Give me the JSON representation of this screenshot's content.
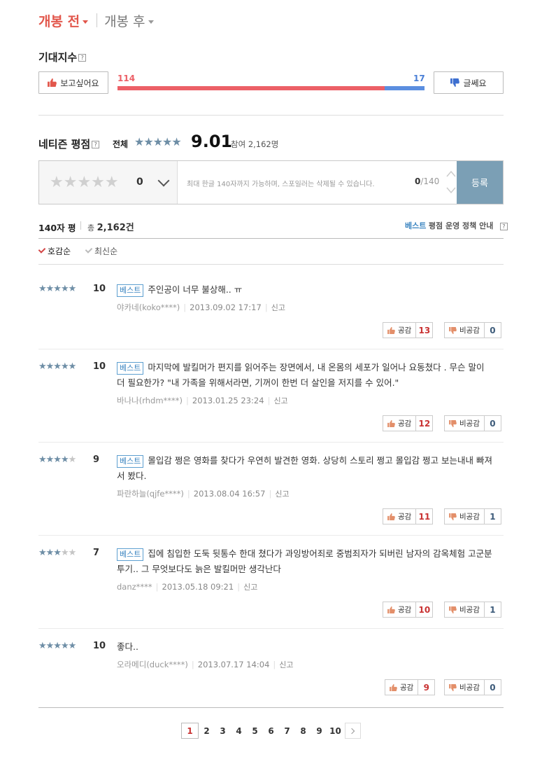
{
  "tabs": {
    "before_label": "개봉 전",
    "after_label": "개봉 후"
  },
  "expectation": {
    "title": "기대지수",
    "help": "?",
    "like_label": "보고싶어요",
    "dislike_label": "글쎄요",
    "like_count": "114",
    "dislike_count": "17",
    "like_ratio": 0.87
  },
  "netizen": {
    "title": "네티즌 평점",
    "help": "?",
    "scope_label": "전체",
    "stars": "★★★★★",
    "score": "9.01",
    "participants": "참여 2,162명"
  },
  "input": {
    "stars": "★★★★★",
    "value": "0",
    "placeholder": "최대 한글 140자까지 가능하며, 스포일러는 삭제될 수 있습니다.",
    "count_current": "0",
    "count_max": "/140",
    "submit_label": "등록"
  },
  "list_header": {
    "title": "140자 평",
    "total_prefix": "총",
    "total": "2,162건",
    "best_label": "베스트",
    "policy_label": "평점 운영 정책 안내",
    "help": "?"
  },
  "sort": {
    "likes_label": "호감순",
    "recent_label": "최신순"
  },
  "reviews": [
    {
      "stars_on": "★★★★★",
      "stars_off": "",
      "score": "10",
      "badge": "베스트",
      "text": "주인공이 너무 불상해.. ㅠ",
      "user": "야카네(koko****)",
      "date": "2013.09.02 17:17",
      "report": "신고",
      "like_label": "공감",
      "likes": "13",
      "dislike_label": "비공감",
      "dislikes": "0"
    },
    {
      "stars_on": "★★★★★",
      "stars_off": "",
      "score": "10",
      "badge": "베스트",
      "text": "마지막에 발킬머가 편지를 읽어주는 장면에서, 내 온몸의 세포가 일어나 요동쳤다 . 무슨 말이 더 필요한가? \"내 가족을 위해서라면, 기꺼이 한번 더 살인을 저지를 수 있어.\"",
      "user": "바나나(rhdm****)",
      "date": "2013.01.25 23:24",
      "report": "신고",
      "like_label": "공감",
      "likes": "12",
      "dislike_label": "비공감",
      "dislikes": "0"
    },
    {
      "stars_on": "★★★★",
      "stars_off": "★",
      "score": "9",
      "badge": "베스트",
      "text": "몰입감 쩡은 영화를 찾다가 우연히 발견한 영화. 상당히 스토리 쩡고 몰입감 쩡고 보는내내 빠져서 봤다.",
      "user": "파란하늘(qjfe****)",
      "date": "2013.08.04 16:57",
      "report": "신고",
      "like_label": "공감",
      "likes": "11",
      "dislike_label": "비공감",
      "dislikes": "1"
    },
    {
      "stars_on": "★★★",
      "stars_off": "★★",
      "score": "7",
      "badge": "베스트",
      "text": "집에 침입한 도둑 뒷통수 한대 쳤다가 과잉방어죄로 중범죄자가 되버린 남자의 감옥체험 고군분투기.. 그 무엇보다도 늙은 발킬머만 생각난다",
      "user": "danz****",
      "date": "2013.05.18 09:21",
      "report": "신고",
      "like_label": "공감",
      "likes": "10",
      "dislike_label": "비공감",
      "dislikes": "1"
    },
    {
      "stars_on": "★★★★★",
      "stars_off": "",
      "score": "10",
      "badge": "",
      "text": "좋다..",
      "user": "오라메디(duck****)",
      "date": "2013.07.17 14:04",
      "report": "신고",
      "like_label": "공감",
      "likes": "9",
      "dislike_label": "비공감",
      "dislikes": "0"
    }
  ],
  "pagination": {
    "pages": [
      "1",
      "2",
      "3",
      "4",
      "5",
      "6",
      "7",
      "8",
      "9",
      "10"
    ],
    "current": "1"
  },
  "colors": {
    "accent_red": "#e2574c",
    "bar_blue": "#5b8ee0",
    "submit_bg": "#7b9fb5",
    "star": "#6e8ea6"
  }
}
